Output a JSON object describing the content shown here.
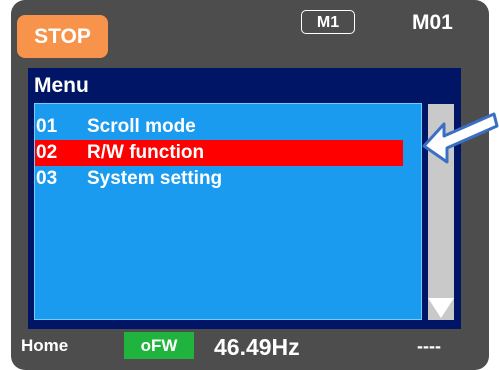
{
  "header": {
    "stop_label": "STOP",
    "mode_badge": "M1",
    "mode_code": "M01"
  },
  "menu": {
    "title": "Menu",
    "items": [
      {
        "num": "01",
        "label": "Scroll mode",
        "selected": false
      },
      {
        "num": "02",
        "label": "R/W function",
        "selected": true
      },
      {
        "num": "03",
        "label": "System setting",
        "selected": false
      }
    ]
  },
  "footer": {
    "home_label": "Home",
    "status_badge": "oFW",
    "frequency": "46.49Hz",
    "dashes": "----"
  },
  "icons": {
    "scroll_down": "triangle-down-icon",
    "pointer": "arrow-icon"
  },
  "colors": {
    "stop": "#f7934a",
    "selected": "#ff0000",
    "menu_background": "#1a9bf0",
    "title_bar": "#001565",
    "status_badge": "#20b43e"
  }
}
